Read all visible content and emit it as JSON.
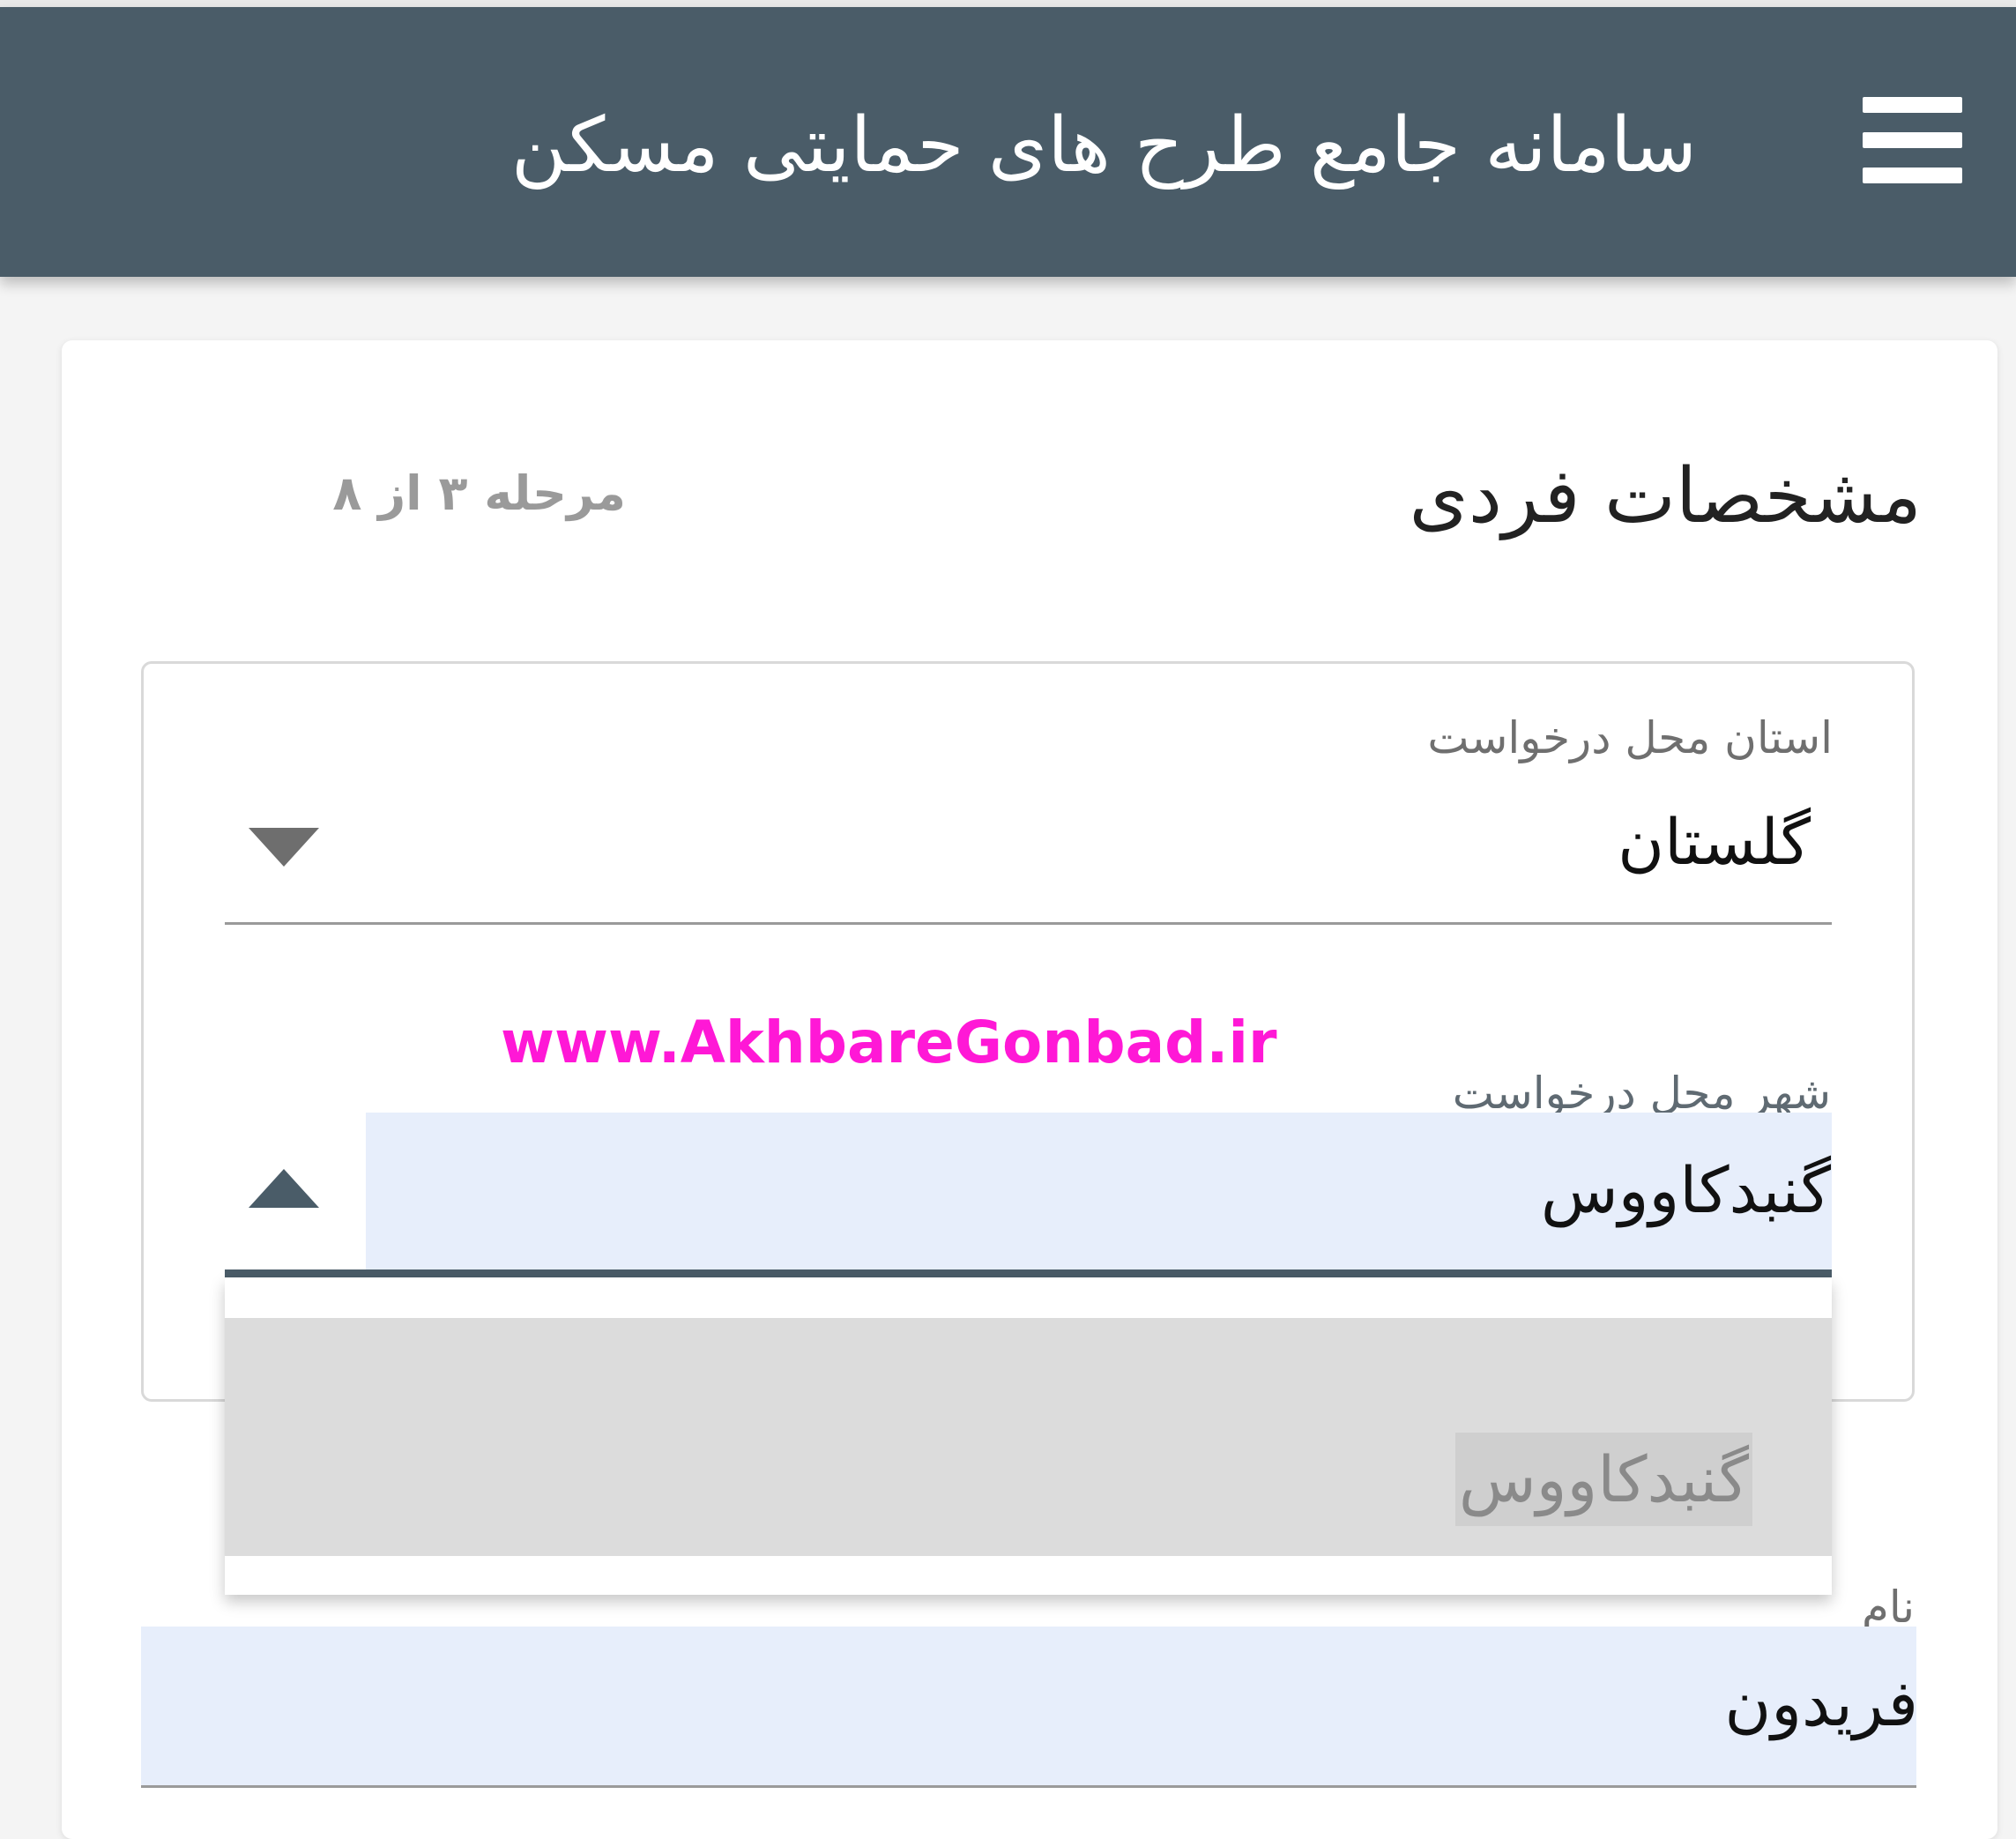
{
  "header": {
    "title": "سامانه جامع طرح های حمایتی مسکن",
    "menu_icon": "hamburger-menu-icon"
  },
  "section": {
    "title": "مشخصات فردی",
    "step": "مرحله ۳ از ۸"
  },
  "fields": {
    "province": {
      "label": "استان محل درخواست",
      "value": "گلستان",
      "state": "collapsed",
      "icon": "chevron-down-icon"
    },
    "city": {
      "label": "شهر محل درخواست",
      "value": "گنبدکاووس",
      "state": "expanded",
      "icon": "chevron-up-icon",
      "options": [
        "گنبدکاووس"
      ]
    },
    "first_name": {
      "label": "نام",
      "value": "فریدون"
    }
  },
  "watermark": "www.AkhbareGonbad.ir",
  "colors": {
    "appbar": "#4a5c68",
    "field_highlight": "#e7eefb",
    "dropdown_option": "#dcdcdc",
    "watermark": "#ff18d6"
  }
}
